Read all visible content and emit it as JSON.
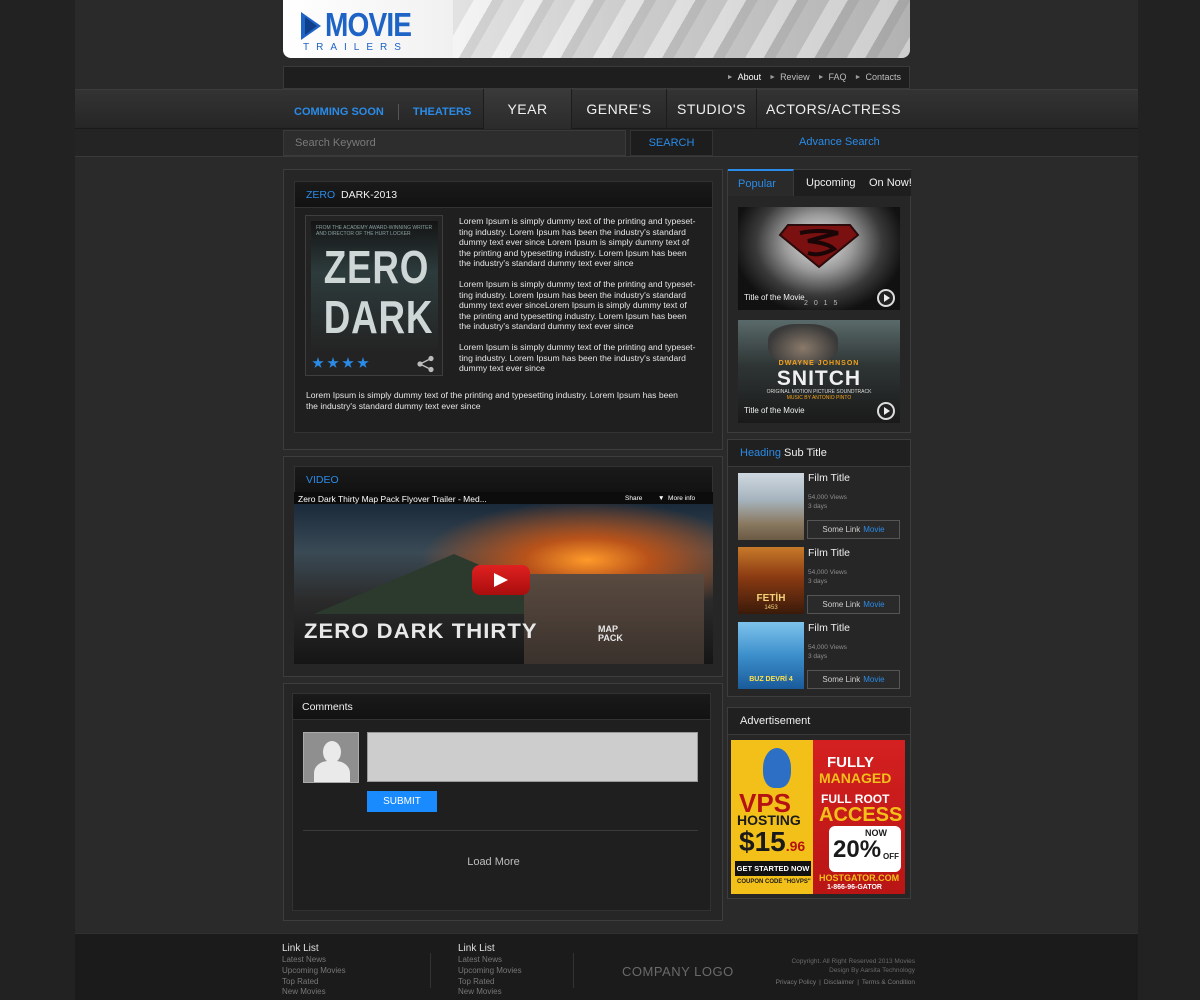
{
  "header": {
    "logo_title": "MOVIE",
    "logo_subtitle": "TRAILERS",
    "top_links": [
      {
        "label": "About"
      },
      {
        "label": "Review"
      },
      {
        "label": "FAQ"
      },
      {
        "label": "Contacts"
      }
    ]
  },
  "nav": {
    "left_links": [
      "COMMING SOON",
      "THEATERS"
    ],
    "tabs": [
      "YEAR",
      "GENRE'S",
      "STUDIO'S",
      "ACTORS/ACTRESS"
    ]
  },
  "search": {
    "placeholder": "Search Keyword",
    "button": "SEARCH",
    "advanced": "Advance Search"
  },
  "movie": {
    "title_highlight": "ZERO",
    "title_rest": "DARK-2013",
    "poster_top": "FROM THE ACADEMY AWARD-WINNING WRITER AND DIRECTOR OF THE HURT LOCKER",
    "poster_word1": "ZERO",
    "poster_word2": "DARK",
    "rating_stars": 4,
    "paragraphs": [
      [
        "Lorem Ipsum is simply dummy text of the printing and typeset-",
        "ting industry. Lorem Ipsum has been the industry's standard",
        "dummy text ever since Lorem Ipsum is simply dummy text of",
        "the printing and typesetting industry. Lorem Ipsum has been",
        "the industry's standard dummy text ever since"
      ],
      [
        "Lorem Ipsum is simply dummy text of the printing and typeset-",
        "ting industry. Lorem Ipsum has been the industry's standard",
        "dummy text ever sinceLorem Ipsum is simply dummy text of",
        "the printing and typesetting industry. Lorem Ipsum has been",
        "the industry's standard dummy text ever since"
      ],
      [
        "Lorem Ipsum is simply dummy text of the printing and typeset-",
        "ting industry. Lorem Ipsum has been the industry's standard",
        "dummy text ever since"
      ]
    ],
    "summary": [
      "Lorem Ipsum is simply dummy text of the printing and typesetting industry. Lorem Ipsum has been",
      "the industry's standard dummy text ever since"
    ]
  },
  "video": {
    "heading": "VIDEO",
    "title": "Zero Dark Thirty Map Pack Flyover Trailer - Med...",
    "share": "Share",
    "more_info": "More info",
    "headline": "ZERO DARK THIRTY",
    "sub1": "MAP",
    "sub2": "PACK"
  },
  "comments": {
    "heading": "Comments",
    "submit": "SUBMIT",
    "load_more": "Load More"
  },
  "sidebar": {
    "tabs": [
      "Popular",
      "Upcoming",
      "On Now!"
    ],
    "trailers": [
      {
        "caption": "Title of the Movie",
        "year_text": "2 0 1 5"
      },
      {
        "caption": "Title of the Movie",
        "name_top": "DWAYNE JOHNSON",
        "name_main": "SNITCH",
        "name_sub": "ORIGINAL MOTION PICTURE SOUNDTRACK",
        "name_sub2": "MUSIC BY ANTONIO PINTO"
      }
    ],
    "heading_highlight": "Heading",
    "heading_rest": "Sub Title",
    "films": [
      {
        "title": "Film Title",
        "views": "54,000 Views",
        "age": "3 days",
        "link": "Some Link",
        "link_highlight": "Movie"
      },
      {
        "title": "Film Title",
        "views": "54,000 Views",
        "age": "3 days",
        "link": "Some Link",
        "link_highlight": "Movie",
        "poster_text": "FETİH",
        "poster_year": "1453"
      },
      {
        "title": "Film Title",
        "views": "54,000 Views",
        "age": "3 days",
        "link": "Some Link",
        "link_highlight": "Movie",
        "poster_text": "BUZ DEVRİ 4"
      }
    ],
    "ad_heading": "Advertisement",
    "ad": {
      "vps": "VPS",
      "hosting": "HOSTING",
      "price": "$15",
      "cents": ".96",
      "cta": "GET STARTED NOW",
      "coupon": "COUPON CODE \"HGVPS\"",
      "fully": "FULLY",
      "managed": "MANAGED",
      "full_root": "FULL ROOT",
      "access": "ACCESS",
      "now": "NOW",
      "percent": "20%",
      "off": "OFF",
      "site": "HOSTGATOR.COM",
      "phone": "1-866-96-GATOR"
    }
  },
  "footer": {
    "col1_title": "Link List",
    "col1_items": [
      "Latest News",
      "Upcoming Movies",
      "Top Rated",
      "New Movies"
    ],
    "col2_title": "Link List",
    "col2_items": [
      "Latest News",
      "Upcoming Movies",
      "Top Rated",
      "New Movies"
    ],
    "company_logo": "COMPANY LOGO",
    "copyright": "Copyright. All Right Reserved 2013 Movies",
    "design": "Design By Aarsita Technology",
    "links": [
      "Privacy Policy",
      "Disclaimer",
      "Terms & Condition"
    ]
  },
  "colors": {
    "accent": "#2a8be8",
    "submit": "#1a8bff",
    "background": "#2a2a2a"
  }
}
